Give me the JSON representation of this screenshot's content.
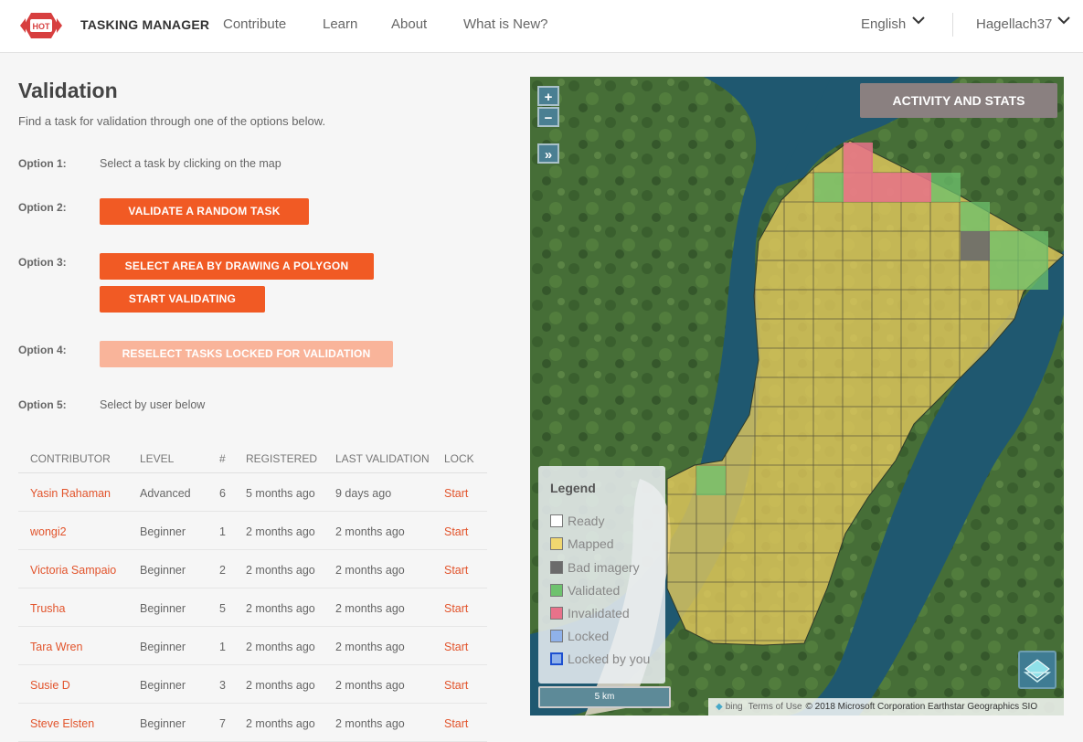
{
  "header": {
    "brand": "TASKING MANAGER",
    "logo_text": "HOT",
    "nav": [
      "Contribute",
      "Learn",
      "About",
      "What is New?"
    ],
    "language": "English",
    "user": "Hagellach37"
  },
  "page": {
    "title": "Validation",
    "subtitle": "Find a task for validation through one of the options below.",
    "options": {
      "o1_label": "Option 1:",
      "o1_text": "Select a task by clicking on the map",
      "o2_label": "Option 2:",
      "o2_button": "VALIDATE A RANDOM TASK",
      "o3_label": "Option 3:",
      "o3_button_draw": "SELECT AREA BY DRAWING A POLYGON",
      "o3_button_start": "START VALIDATING",
      "o4_label": "Option 4:",
      "o4_button": "RESELECT TASKS LOCKED FOR VALIDATION",
      "o5_label": "Option 5:",
      "o5_text": "Select by user below"
    }
  },
  "table": {
    "headers": [
      "CONTRIBUTOR",
      "LEVEL",
      "#",
      "REGISTERED",
      "LAST VALIDATION",
      "LOCK"
    ],
    "rows": [
      {
        "contributor": "Yasin Rahaman",
        "level": "Advanced",
        "count": "6",
        "registered": "5 months ago",
        "last": "9 days ago",
        "lock": "Start"
      },
      {
        "contributor": "wongi2",
        "level": "Beginner",
        "count": "1",
        "registered": "2 months ago",
        "last": "2 months ago",
        "lock": "Start"
      },
      {
        "contributor": "Victoria Sampaio",
        "level": "Beginner",
        "count": "2",
        "registered": "2 months ago",
        "last": "2 months ago",
        "lock": "Start"
      },
      {
        "contributor": "Trusha",
        "level": "Beginner",
        "count": "5",
        "registered": "2 months ago",
        "last": "2 months ago",
        "lock": "Start"
      },
      {
        "contributor": "Tara Wren",
        "level": "Beginner",
        "count": "1",
        "registered": "2 months ago",
        "last": "2 months ago",
        "lock": "Start"
      },
      {
        "contributor": "Susie D",
        "level": "Beginner",
        "count": "3",
        "registered": "2 months ago",
        "last": "2 months ago",
        "lock": "Start"
      },
      {
        "contributor": "Steve Elsten",
        "level": "Beginner",
        "count": "7",
        "registered": "2 months ago",
        "last": "2 months ago",
        "lock": "Start"
      }
    ]
  },
  "map": {
    "zoom_in": "+",
    "zoom_out": "−",
    "expand": "»",
    "activity_button": "ACTIVITY AND STATS",
    "legend": {
      "title": "Legend",
      "items": [
        {
          "label": "Ready",
          "color": "#ffffff"
        },
        {
          "label": "Mapped",
          "color": "#f0d770"
        },
        {
          "label": "Bad imagery",
          "color": "#6b6b6b"
        },
        {
          "label": "Validated",
          "color": "#6ec26e"
        },
        {
          "label": "Invalidated",
          "color": "#e8728a"
        },
        {
          "label": "Locked",
          "color": "#8fb1ea"
        },
        {
          "label": "Locked by you",
          "color": "#8fb1ea"
        }
      ]
    },
    "scale": "5 km",
    "attribution": {
      "bing": "bing",
      "terms": "Terms of Use",
      "copyright": "© 2018 Microsoft Corporation Earthstar Geographics SIO"
    }
  },
  "colors": {
    "accent": "#f15a24",
    "accent_light": "#f9b49a",
    "link": "#e2542c"
  }
}
